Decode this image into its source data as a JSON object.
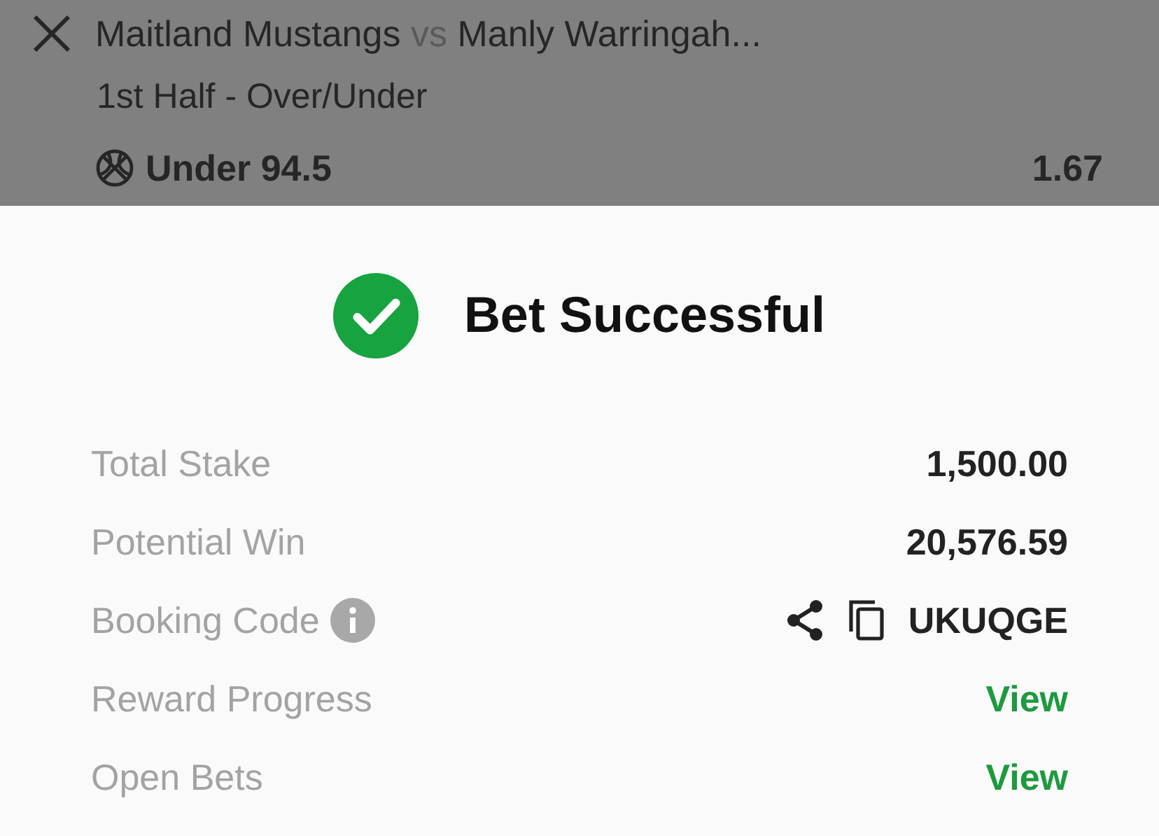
{
  "bet": {
    "home_team": "Maitland Mustangs",
    "separator": "vs",
    "away_team": "Manly Warringah...",
    "market": "1st Half - Over/Under",
    "selection": "Under 94.5",
    "odds": "1.67"
  },
  "result": {
    "title": "Bet Successful"
  },
  "rows": [
    {
      "kind": "value",
      "label": "Total Stake",
      "value": "1,500.00"
    },
    {
      "kind": "value",
      "label": "Potential Win",
      "value": "20,576.59"
    },
    {
      "kind": "code",
      "label": "Booking Code",
      "value": "UKUQGE"
    },
    {
      "kind": "link",
      "label": "Reward Progress",
      "value": "View"
    },
    {
      "kind": "link",
      "label": "Open Bets",
      "value": "View"
    }
  ]
}
